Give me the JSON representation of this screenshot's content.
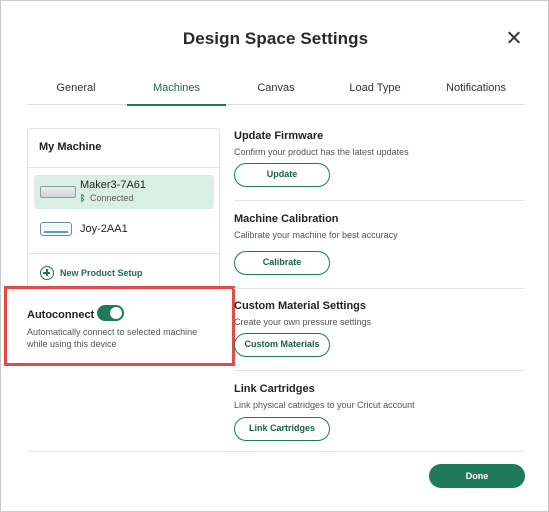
{
  "dialog": {
    "title": "Design Space Settings"
  },
  "tabs": [
    {
      "label": "General"
    },
    {
      "label": "Machines",
      "active": true
    },
    {
      "label": "Canvas"
    },
    {
      "label": "Load Type"
    },
    {
      "label": "Notifications"
    }
  ],
  "my_machine": {
    "heading": "My Machine",
    "machines": [
      {
        "name": "Maker3-7A61",
        "status": "Connected",
        "selected": true,
        "icon": "maker-machine-icon"
      },
      {
        "name": "Joy-2AA1",
        "status": "",
        "selected": false,
        "icon": "joy-machine-icon"
      }
    ],
    "new_setup_label": "New Product Setup"
  },
  "autoconnect": {
    "label": "Autoconnect",
    "enabled": true,
    "description": "Automatically connect to selected machine while using this device"
  },
  "sections": {
    "firmware": {
      "title": "Update Firmware",
      "description": "Confirm your product has the latest updates",
      "button": "Update"
    },
    "calibration": {
      "title": "Machine Calibration",
      "description": "Calibrate your machine for best accuracy",
      "button": "Calibrate"
    },
    "materials": {
      "title": "Custom Material Settings",
      "description": "Create your own pressure settings",
      "button": "Custom Materials"
    },
    "cartridges": {
      "title": "Link Cartridges",
      "description": "Link physical catridges to your Cricut account",
      "button": "Link Cartridges"
    }
  },
  "footer": {
    "done_label": "Done"
  },
  "colors": {
    "accent": "#1f7a5c",
    "selected_row": "#d9eee5",
    "highlight_border": "#e24b47"
  }
}
